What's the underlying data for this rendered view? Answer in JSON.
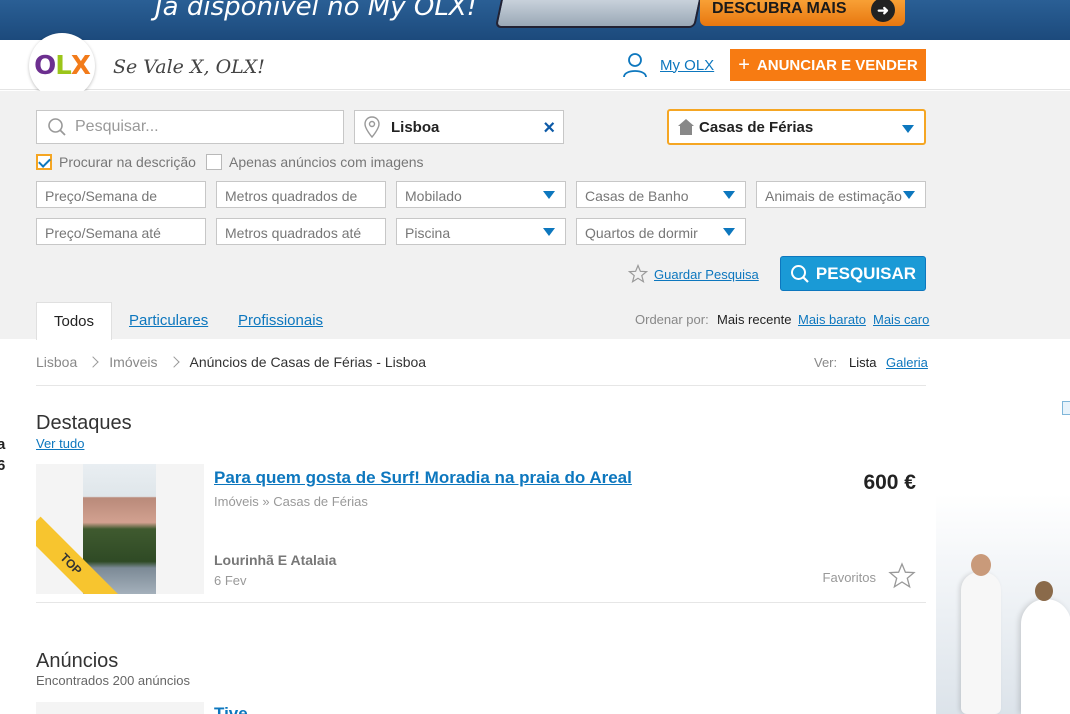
{
  "banner": {
    "text": "Já disponível no My OLX!",
    "cta": "DESCUBRA MAIS"
  },
  "header": {
    "logo": {
      "o": "O",
      "l": "L",
      "x": "X"
    },
    "slogan": "Se Vale X, OLX!",
    "my_olx": "My OLX",
    "post_button": "ANUNCIAR E VENDER",
    "post_plus": "+"
  },
  "search": {
    "placeholder": "Pesquisar...",
    "location": "Lisboa",
    "clear": "×",
    "category": "Casas de Férias",
    "checkbox_description": "Procurar na descrição",
    "checkbox_images": "Apenas anúncios com imagens",
    "filters_row1": [
      "Preço/Semana de",
      "Metros quadrados de",
      "Mobilado",
      "Casas de Banho",
      "Animais de estimação"
    ],
    "filters_row2": [
      "Preço/Semana até",
      "Metros quadrados até",
      "Piscina",
      "Quartos de dormir"
    ],
    "save_search": "Guardar Pesquisa",
    "search_button": "PESQUISAR"
  },
  "tabs": {
    "all": "Todos",
    "private": "Particulares",
    "professional": "Profissionais"
  },
  "order": {
    "label": "Ordenar por:",
    "recent": "Mais recente",
    "cheap": "Mais barato",
    "expensive": "Mais caro"
  },
  "breadcrumb": {
    "city": "Lisboa",
    "category": "Imóveis",
    "current": "Anúncios de Casas de Férias - Lisboa"
  },
  "view": {
    "label": "Ver:",
    "list": "Lista",
    "gallery": "Galeria"
  },
  "featured": {
    "title": "Destaques",
    "see_all": "Ver tudo",
    "ad": {
      "badge": "TOP",
      "title": "Para quem gosta de Surf! Moradia na praia do Areal",
      "category": "Imóveis » Casas de Férias",
      "location": "Lourinhã E Atalaia",
      "date": "6 Fev",
      "price": "600 €",
      "favorites": "Favoritos"
    }
  },
  "listings": {
    "title": "Anúncios",
    "count": "Encontrados 200 anúncios",
    "next_title": "Tive...",
    "next_price": "..."
  },
  "left_edge": {
    "line1": "a",
    "line2": "6"
  },
  "colors": {
    "brand_orange": "#f77b12",
    "link_blue": "#0d77be",
    "search_blue": "#1a9ad6",
    "highlight_border": "#f5a623",
    "top_badge": "#f7c52f"
  }
}
